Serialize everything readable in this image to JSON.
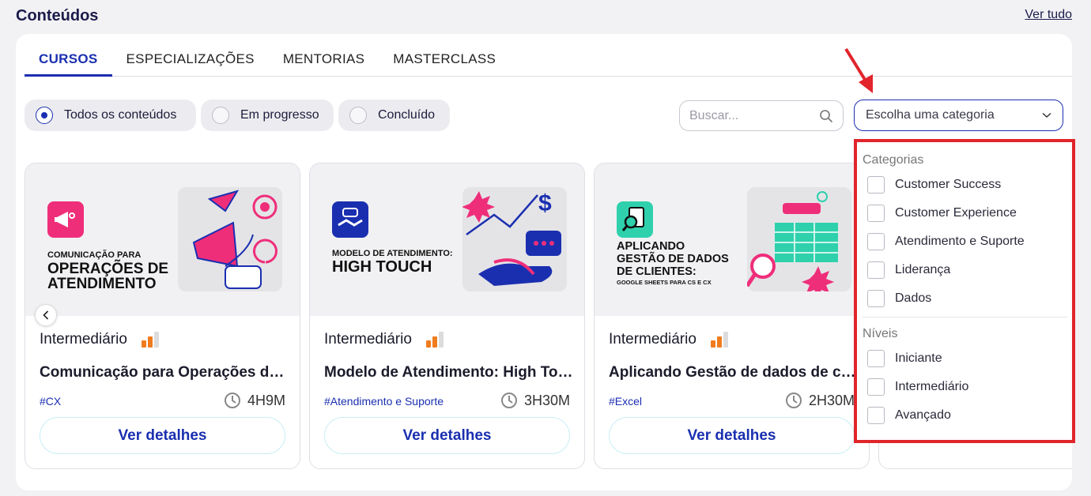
{
  "header": {
    "title": "Conteúdos",
    "see_all": "Ver tudo"
  },
  "tabs": [
    {
      "label": "CURSOS",
      "active": true
    },
    {
      "label": "ESPECIALIZAÇÕES",
      "active": false
    },
    {
      "label": "MENTORIAS",
      "active": false
    },
    {
      "label": "MASTERCLASS",
      "active": false
    }
  ],
  "filters": [
    {
      "label": "Todos os conteúdos",
      "checked": true
    },
    {
      "label": "Em progresso",
      "checked": false
    },
    {
      "label": "Concluído",
      "checked": false
    }
  ],
  "search": {
    "placeholder": "Buscar..."
  },
  "category_select": {
    "placeholder": "Escolha uma categoria"
  },
  "dropdown": {
    "categories_label": "Categorias",
    "categories": [
      "Customer Success",
      "Customer Experience",
      "Atendimento e Suporte",
      "Liderança",
      "Dados"
    ],
    "levels_label": "Níveis",
    "levels": [
      "Iniciante",
      "Intermediário",
      "Avançado"
    ]
  },
  "cards": [
    {
      "banner_line1": "COMUNICAÇÃO PARA",
      "banner_line2": "OPERAÇÕES DE",
      "banner_line3": "ATENDIMENTO",
      "level": "Intermediário",
      "level_value": 2,
      "level_max": 3,
      "title": "Comunicação para Operações de Atendimento",
      "tag": "#CX",
      "duration": "4H9M",
      "button": "Ver detalhes"
    },
    {
      "banner_line1": "MODELO DE ATENDIMENTO:",
      "banner_line2": "HIGH TOUCH",
      "level": "Intermediário",
      "level_value": 2,
      "level_max": 3,
      "title": "Modelo de Atendimento: High Touch",
      "tag": "#Atendimento e Suporte",
      "duration": "3H30M",
      "button": "Ver detalhes"
    },
    {
      "banner_line1": "APLICANDO",
      "banner_line2": "GESTÃO DE DADOS",
      "banner_line3": "DE CLIENTES:",
      "banner_line4": "GOOGLE SHEETS PARA CS E CX",
      "level": "Intermediário",
      "level_value": 2,
      "level_max": 3,
      "title": "Aplicando Gestão de dados de clientes",
      "tag": "#Excel",
      "duration": "2H30M",
      "button": "Ver detalhes"
    }
  ],
  "colors": {
    "brand_blue": "#1a2fb0",
    "level_orange": "#f07c1e",
    "highlight_red": "#e1252b",
    "pink": "#ef2e7a",
    "teal": "#2fd1ad"
  }
}
